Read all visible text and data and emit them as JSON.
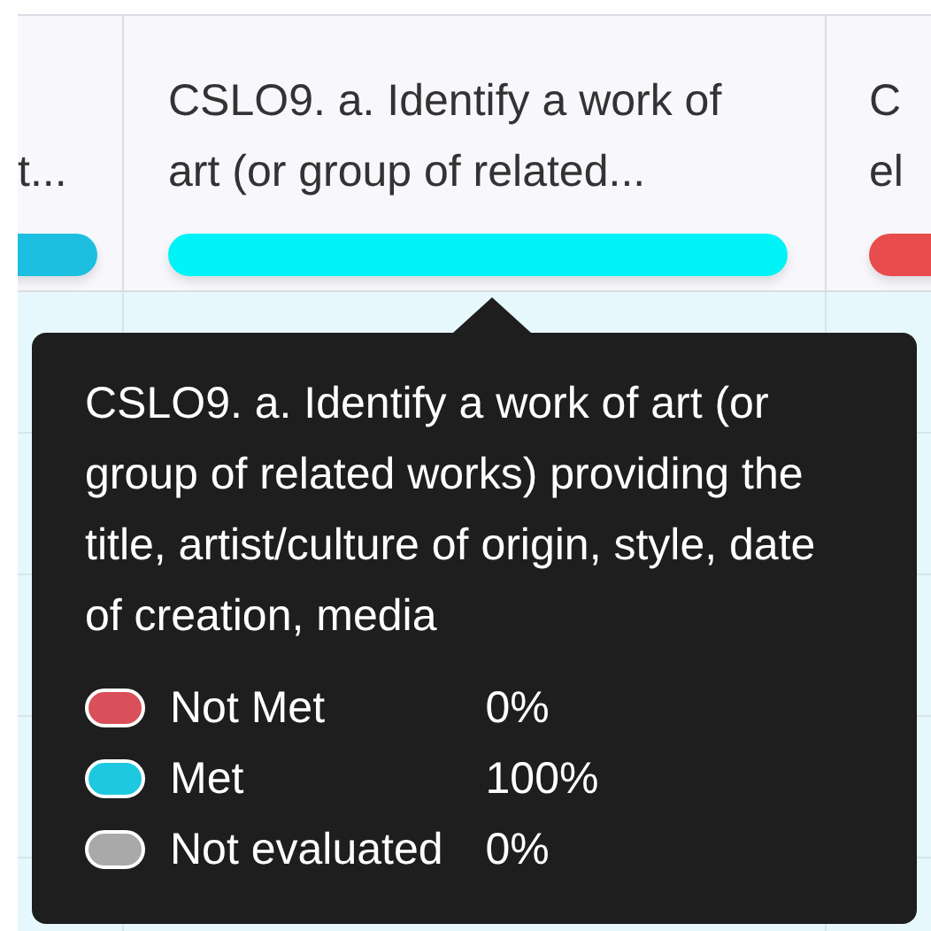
{
  "header_columns": [
    {
      "text": "t...",
      "color": "#1cbfe0"
    },
    {
      "text": "CSLO9. a. Identify a work of art (or group of related...",
      "color": "#00f3f7"
    },
    {
      "text": "C el",
      "color": "#e84c4c"
    }
  ],
  "tooltip": {
    "title": "CSLO9. a. Identify a work of art (or group of related works) providing the title, artist/culture of origin, style, date of creation, media",
    "legend": [
      {
        "label": "Not Met",
        "value": "0%",
        "color": "#d9505a"
      },
      {
        "label": "Met",
        "value": "100%",
        "color": "#1ec8e0"
      },
      {
        "label": "Not evaluated",
        "value": "0%",
        "color": "#a9a9a9"
      }
    ]
  }
}
